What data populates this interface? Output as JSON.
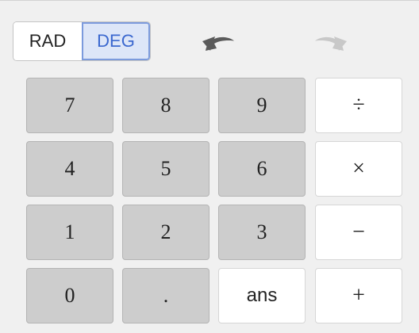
{
  "angle_mode": {
    "options": [
      "RAD",
      "DEG"
    ],
    "selected": "DEG"
  },
  "history": {
    "undo_icon": "undo-arrow-icon",
    "redo_icon": "redo-arrow-icon",
    "undo_enabled": true,
    "redo_enabled": false
  },
  "colors": {
    "number_key_bg": "#cdcdcd",
    "operator_key_bg": "#ffffff",
    "selected_mode_bg": "#dde6f8",
    "selected_mode_text": "#3b68cf",
    "panel_bg": "#f0f0f0"
  },
  "keypad": {
    "rows": [
      [
        "7",
        "8",
        "9",
        "÷"
      ],
      [
        "4",
        "5",
        "6",
        "×"
      ],
      [
        "1",
        "2",
        "3",
        "−"
      ],
      [
        "0",
        ".",
        "ans",
        "+"
      ]
    ]
  }
}
